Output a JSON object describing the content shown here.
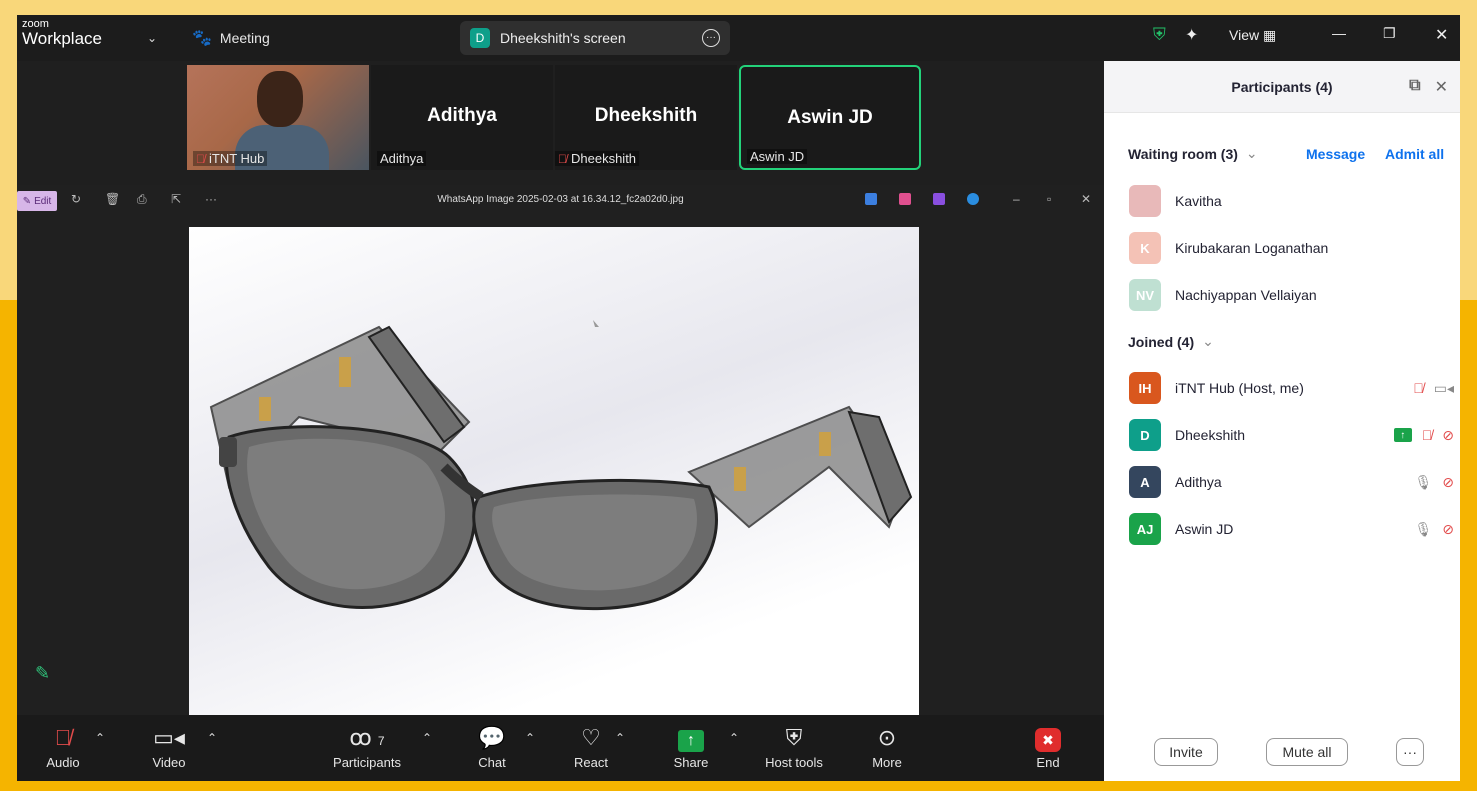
{
  "app": {
    "logo_line1": "zoom",
    "logo_line2": "Workplace"
  },
  "titlebar": {
    "meeting_label": "Meeting",
    "screen_share_badge": "D",
    "screen_share_label": "Dheekshith's screen",
    "view_label": "View"
  },
  "thumbnails": [
    {
      "display": "",
      "name": "iTNT Hub",
      "muted": true,
      "video": true
    },
    {
      "display": "Adithya",
      "name": "Adithya",
      "muted": false,
      "video": false
    },
    {
      "display": "Dheekshith",
      "name": "Dheekshith",
      "muted": true,
      "video": false
    },
    {
      "display": "Aswin JD",
      "name": "Aswin JD",
      "muted": false,
      "video": false,
      "active_speaker": true
    }
  ],
  "viewer": {
    "edit_label": "Edit",
    "file_title": "WhatsApp Image 2025-02-03 at 16.34.12_fc2a02d0.jpg"
  },
  "toolbar": {
    "audio": "Audio",
    "video": "Video",
    "participants": "Participants",
    "participants_count": "7",
    "chat": "Chat",
    "react": "React",
    "share": "Share",
    "host_tools": "Host tools",
    "more": "More",
    "end": "End"
  },
  "panel": {
    "title": "Participants (4)",
    "waiting_room": "Waiting room (3)",
    "message_link": "Message",
    "admit_all_link": "Admit all",
    "waiting": [
      {
        "initials": "",
        "name": "Kavitha",
        "color": "#e8b9b9"
      },
      {
        "initials": "K",
        "name": "Kirubakaran Loganathan",
        "color": "#f4c2b6"
      },
      {
        "initials": "NV",
        "name": "Nachiyappan Vellaiyan",
        "color": "#bfe0d2"
      }
    ],
    "joined_label": "Joined (4)",
    "joined": [
      {
        "initials": "IH",
        "name": "iTNT Hub (Host, me)",
        "color": "#d9571e"
      },
      {
        "initials": "D",
        "name": "Dheekshith",
        "color": "#0e9f8a"
      },
      {
        "initials": "A",
        "name": "Adithya",
        "color": "#34465e"
      },
      {
        "initials": "AJ",
        "name": "Aswin JD",
        "color": "#1aa34a"
      }
    ],
    "invite_button": "Invite",
    "mute_all_button": "Mute all",
    "more_button": "···"
  }
}
